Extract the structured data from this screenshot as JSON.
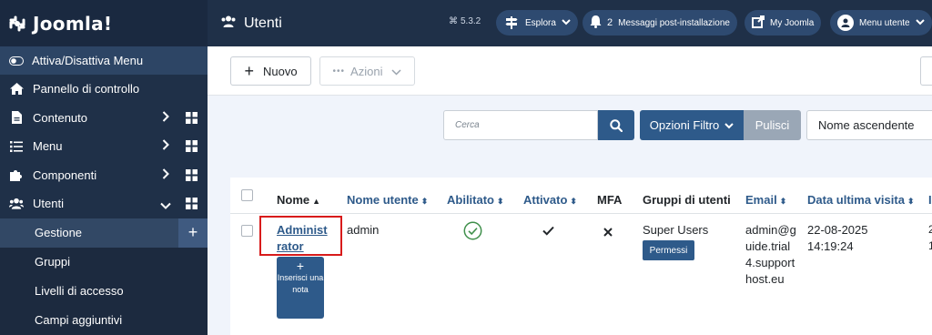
{
  "brand": {
    "name": "Joomla!"
  },
  "sidebar": {
    "toggle_label": "Attiva/Disattiva Menu",
    "items": [
      {
        "label": "Pannello di controllo",
        "icon": "home-icon"
      },
      {
        "label": "Contenuto",
        "icon": "file-icon"
      },
      {
        "label": "Menu",
        "icon": "list-icon"
      },
      {
        "label": "Componenti",
        "icon": "puzzle-icon"
      },
      {
        "label": "Utenti",
        "icon": "users-icon"
      }
    ],
    "sub_items": [
      {
        "label": "Gestione"
      },
      {
        "label": "Gruppi"
      },
      {
        "label": "Livelli di accesso"
      },
      {
        "label": "Campi aggiuntivi"
      }
    ]
  },
  "header": {
    "title": "Utenti",
    "version": "5.3.2",
    "explore_label": "Esplora",
    "messages_count": "2",
    "messages_label": "Messaggi post-installazione",
    "my_joomla_label": "My Joomla",
    "user_menu_label": "Menu utente"
  },
  "toolbar": {
    "new_label": "Nuovo",
    "actions_label": "Azioni"
  },
  "filters": {
    "search_placeholder": "Cerca",
    "filter_options_label": "Opzioni Filtro",
    "clear_label": "Pulisci",
    "sort_value": "Nome ascendente"
  },
  "table": {
    "headers": {
      "name": "Nome",
      "username": "Nome utente",
      "enabled": "Abilitato",
      "activated": "Attivato",
      "mfa": "MFA",
      "groups": "Gruppi di utenti",
      "email": "Email",
      "last_visit": "Data ultima visita",
      "cutoff": "I"
    },
    "rows": [
      {
        "name": "Administrator",
        "username": "admin",
        "enabled": "check-circle-icon",
        "activated": "check-icon",
        "mfa": "x-icon",
        "groups": "Super Users",
        "permissions_label": "Permessi",
        "email": "admin@guide.trial4.supporthost.eu",
        "last_visit_date": "22-08-2025",
        "last_visit_time": "14:19:24",
        "note_button": "Inserisci una nota",
        "cutoff_1": "2",
        "cutoff_2": "1"
      }
    ]
  },
  "colors": {
    "sidebar": "#1f3048",
    "primary": "#2e5a8a",
    "highlight": "#d81b1b"
  }
}
